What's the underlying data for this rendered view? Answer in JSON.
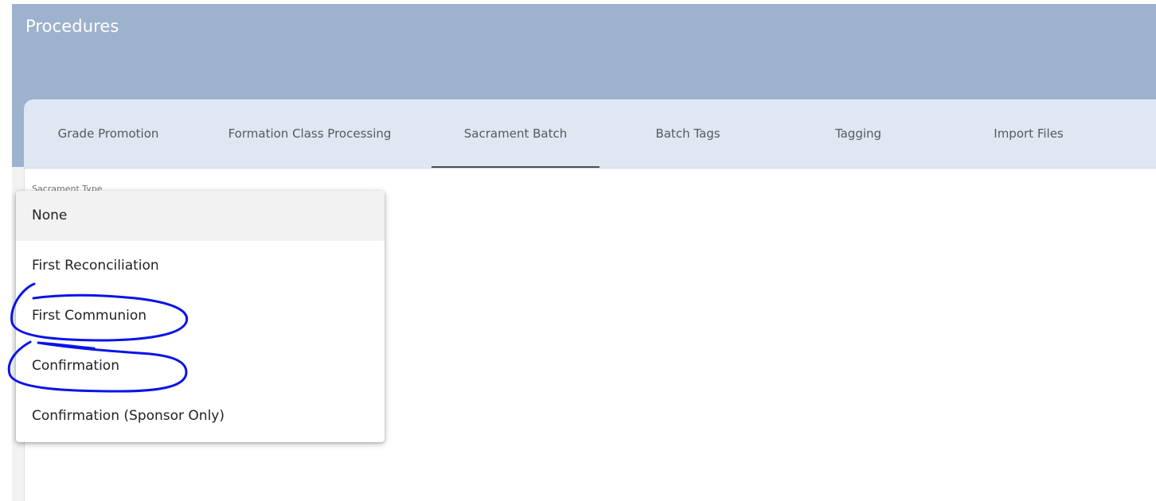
{
  "header": {
    "title": "Procedures"
  },
  "tabs": [
    {
      "label": "Grade Promotion"
    },
    {
      "label": "Formation Class Processing"
    },
    {
      "label": "Sacrament Batch"
    },
    {
      "label": "Batch Tags"
    },
    {
      "label": "Tagging"
    },
    {
      "label": "Import Files"
    }
  ],
  "active_tab": "Sacrament Batch",
  "form": {
    "sacrament_type_label": "Sacrament Type"
  },
  "dropdown": {
    "selected_value": "None",
    "options": [
      {
        "label": "None"
      },
      {
        "label": "First Reconciliation"
      },
      {
        "label": "First Communion"
      },
      {
        "label": "Confirmation"
      },
      {
        "label": "Confirmation (Sponsor Only)"
      }
    ]
  },
  "colors": {
    "header_bg": "#9db2cd",
    "tabs_bg": "#dfe7f2",
    "annotation_ink": "#0a14e6"
  }
}
